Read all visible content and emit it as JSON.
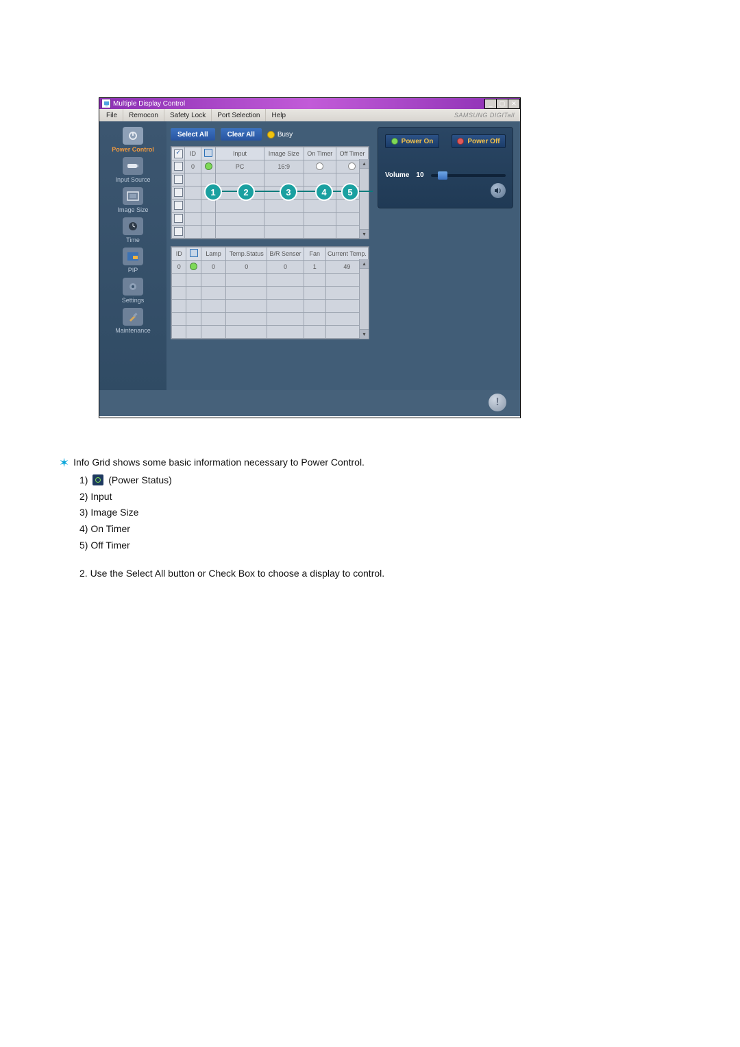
{
  "window": {
    "title": "Multiple Display Control",
    "brand": "SAMSUNG DIGITall"
  },
  "menu": {
    "file": "File",
    "remocon": "Remocon",
    "safety": "Safety Lock",
    "port": "Port Selection",
    "help": "Help"
  },
  "sidebar": {
    "items": [
      {
        "label": "Power Control"
      },
      {
        "label": "Input Source"
      },
      {
        "label": "Image Size"
      },
      {
        "label": "Time"
      },
      {
        "label": "PIP"
      },
      {
        "label": "Settings"
      },
      {
        "label": "Maintenance"
      }
    ]
  },
  "toolbar": {
    "select_all": "Select All",
    "clear_all": "Clear All",
    "busy": "Busy"
  },
  "grid1": {
    "headers": {
      "chk": "",
      "id": "ID",
      "status": "",
      "input": "Input",
      "image": "Image Size",
      "on": "On Timer",
      "off": "Off Timer"
    },
    "rows": [
      {
        "checked": true,
        "id": "0",
        "status": "on",
        "input": "PC",
        "image": "16:9",
        "on": "○",
        "off": "○"
      },
      {
        "checked": false,
        "id": "",
        "status": "",
        "input": "",
        "image": "",
        "on": "",
        "off": ""
      },
      {
        "checked": false,
        "id": "",
        "status": "",
        "input": "",
        "image": "",
        "on": "",
        "off": ""
      },
      {
        "checked": false,
        "id": "",
        "status": "",
        "input": "",
        "image": "",
        "on": "",
        "off": ""
      },
      {
        "checked": false,
        "id": "",
        "status": "",
        "input": "",
        "image": "",
        "on": "",
        "off": ""
      },
      {
        "checked": false,
        "id": "",
        "status": "",
        "input": "",
        "image": "",
        "on": "",
        "off": ""
      }
    ]
  },
  "grid2": {
    "headers": {
      "id": "ID",
      "status": "",
      "lamp": "Lamp",
      "temp": "Temp.Status",
      "br": "B/R Senser",
      "fan": "Fan",
      "cur": "Current Temp."
    },
    "rows": [
      {
        "id": "0",
        "status": "on",
        "lamp": "0",
        "temp": "0",
        "br": "0",
        "fan": "1",
        "cur": "49"
      },
      {
        "id": "",
        "status": "",
        "lamp": "",
        "temp": "",
        "br": "",
        "fan": "",
        "cur": ""
      },
      {
        "id": "",
        "status": "",
        "lamp": "",
        "temp": "",
        "br": "",
        "fan": "",
        "cur": ""
      },
      {
        "id": "",
        "status": "",
        "lamp": "",
        "temp": "",
        "br": "",
        "fan": "",
        "cur": ""
      },
      {
        "id": "",
        "status": "",
        "lamp": "",
        "temp": "",
        "br": "",
        "fan": "",
        "cur": ""
      },
      {
        "id": "",
        "status": "",
        "lamp": "",
        "temp": "",
        "br": "",
        "fan": "",
        "cur": ""
      }
    ]
  },
  "callouts": [
    "1",
    "2",
    "3",
    "4",
    "5"
  ],
  "power": {
    "on": "Power On",
    "off": "Power Off",
    "volume_label": "Volume",
    "volume_value": "10"
  },
  "desc": {
    "intro": "Info Grid shows some basic information necessary to Power Control.",
    "items": {
      "n1": "1)",
      "v1": "(Power Status)",
      "n2": "2)",
      "v2": "Input",
      "n3": "3)",
      "v3": "Image Size",
      "n4": "4)",
      "v4": "On Timer",
      "n5": "5)",
      "v5": "Off Timer"
    },
    "note": "2.  Use the Select All button or Check Box to choose a display to control."
  }
}
